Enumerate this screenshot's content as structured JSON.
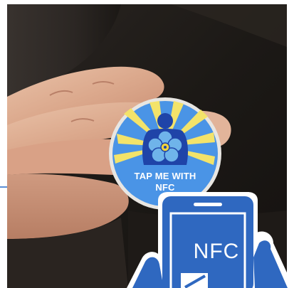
{
  "photo": {
    "subject": "hand-holding-nfc-sticker",
    "badge": {
      "line1": "TAP ME WITH",
      "line2": "NFC",
      "colors": {
        "ring": "#e8e6e2",
        "sky": "#4a94e6",
        "rays": "#f3e36a",
        "figure": "#1f44a8",
        "flower": "#6fb4ea",
        "flower_center": "#f0d23a"
      }
    },
    "phone_overlay": {
      "screen_text": "NFC",
      "colors": {
        "phone": "#2f68c0",
        "hand": "#2f68c0"
      }
    },
    "guide_line_color": "#5b8fd6"
  }
}
